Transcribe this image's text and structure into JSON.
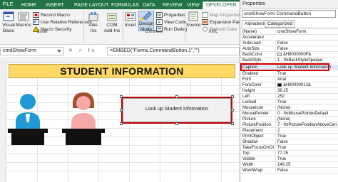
{
  "ribbon": {
    "tabs": [
      {
        "label": "FILE"
      },
      {
        "label": "HOME"
      },
      {
        "label": "INSERT"
      },
      {
        "label": "PAGE LAYOUT"
      },
      {
        "label": "FORMULAS"
      },
      {
        "label": "DATA"
      },
      {
        "label": "REVIEW"
      },
      {
        "label": "VIEW"
      },
      {
        "label": "DEVELOPER"
      }
    ],
    "visual_basic": "Visual Basic",
    "macros": "Macros",
    "record_macro": "Record Macro",
    "use_relative": "Use Relative References",
    "macro_security": "Macro Security",
    "group_code": "Code",
    "addins": "Add-Ins",
    "com_addins": "COM Add-Ins",
    "insert": "Insert",
    "design_mode": "Design Mode",
    "properties": "Properties",
    "view_code": "View Code",
    "run_dialog": "Run Dialog",
    "group_controls": "Controls",
    "source": "Source",
    "map_properties": "Map Properties",
    "expansion_packs": "Expansion Packs",
    "refresh_data": "Refresh Data",
    "group_xml": "XML"
  },
  "formula_bar": {
    "name_box": "cmdShowForm",
    "fx_icons": "✕ ✓ fx",
    "formula": "=EMBED(\"Forms.CommandButton.1\",\"\")"
  },
  "sheet": {
    "banner_title": "STUDENT INFORMATION",
    "button_caption": "Look up Student Information"
  },
  "properties": {
    "title": "Properties",
    "object": "cmdShowForm  CommandButton",
    "tab_alphabetic": "Alphabetic",
    "tab_categorized": "Categorized",
    "rows": [
      {
        "name": "(Name)",
        "value": "cmdShowForm"
      },
      {
        "name": "Accelerator",
        "value": ""
      },
      {
        "name": "AutoLoad",
        "value": "False"
      },
      {
        "name": "AutoSize",
        "value": "False"
      },
      {
        "name": "BackColor",
        "value": "&H8000000F&"
      },
      {
        "name": "BackStyle",
        "value": "1 - fmBackStyleOpaque"
      },
      {
        "name": "Caption",
        "value": "Look up Student Information"
      },
      {
        "name": "Enabled",
        "value": "True"
      },
      {
        "name": "Font",
        "value": "Arial"
      },
      {
        "name": "ForeColor",
        "value": "&H80000012&"
      },
      {
        "name": "Height",
        "value": "36.25"
      },
      {
        "name": "Left",
        "value": "252"
      },
      {
        "name": "Locked",
        "value": "True"
      },
      {
        "name": "MouseIcon",
        "value": "(None)"
      },
      {
        "name": "MousePointer",
        "value": "0 - fmMousePointerDefault"
      },
      {
        "name": "Picture",
        "value": "(None)"
      },
      {
        "name": "PicturePosition",
        "value": "7 - fmPicturePositionAboveCenter"
      },
      {
        "name": "Placement",
        "value": "2"
      },
      {
        "name": "PrintObject",
        "value": "True"
      },
      {
        "name": "Shadow",
        "value": "False"
      },
      {
        "name": "TakeFocusOnClick",
        "value": "True"
      },
      {
        "name": "Top",
        "value": "77.25"
      },
      {
        "name": "Visible",
        "value": "True"
      },
      {
        "name": "Width",
        "value": "149.25"
      },
      {
        "name": "WordWrap",
        "value": "False"
      }
    ]
  },
  "colors": {
    "ribbon_green": "#217346",
    "banner_fill": "#ffd966",
    "boy_blue": "#1f9ad6",
    "girl_pink": "#f6a8a8",
    "girl_hair": "#a0522d",
    "selection_red": "#d40000"
  }
}
